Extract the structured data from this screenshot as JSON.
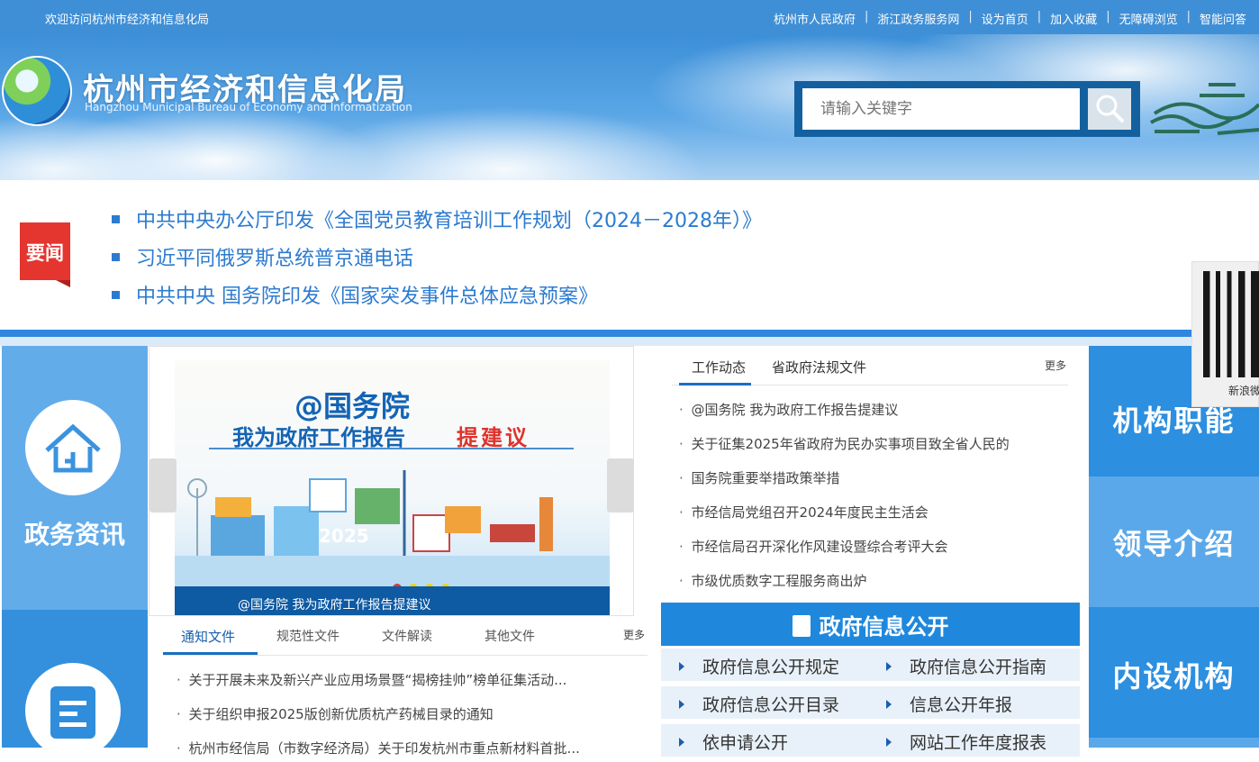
{
  "topbar": {
    "welcome": "欢迎访问杭州市经济和信息化局",
    "links": [
      "杭州市人民政府",
      "浙江政务服务网",
      "设为首页",
      "加入收藏",
      "无障碍浏览",
      "智能问答"
    ]
  },
  "header": {
    "title": "杭州市经济和信息化局",
    "subtitle": "Hangzhou Municipal Bureau of Economy and Informatization",
    "search_placeholder": "请输入关键字"
  },
  "headlines": {
    "badge": "要闻",
    "items": [
      "中共中央办公厅印发《全国党员教育培训工作规划（2024－2028年）》",
      "习近平同俄罗斯总统普京通电话",
      "中共中央  国务院印发《国家突发事件总体应急预案》"
    ]
  },
  "left_column": {
    "items": [
      {
        "label": "政务资讯",
        "icon": "home-icon"
      },
      {
        "label": "",
        "icon": "document-icon"
      }
    ]
  },
  "carousel": {
    "slide_title": "@国务院",
    "slide_line_blue": "我为政府工作报告",
    "slide_line_red": "提建议",
    "slide_year": "2025",
    "caption": "@国务院 我为政府工作报告提建议",
    "dots": 4,
    "active_dot": 0
  },
  "notice": {
    "tabs": [
      "通知文件",
      "规范性文件",
      "文件解读",
      "其他文件"
    ],
    "more": "更多",
    "items": [
      "关于开展未来及新兴产业应用场景暨“揭榜挂帅”榜单征集活动...",
      "关于组织申报2025版创新优质杭产药械目录的通知",
      "杭州市经信局（市数字经济局）关于印发杭州市重点新材料首批..."
    ]
  },
  "work": {
    "tabs": [
      "工作动态",
      "省政府法规文件"
    ],
    "more": "更多",
    "items": [
      "@国务院 我为政府工作报告提建议",
      "关于征集2025年省政府为民办实事项目致全省人民的",
      "国务院重要举措政策举措",
      "市经信局党组召开2024年度民主生活会",
      "市经信局召开深化作风建设暨综合考评大会",
      "市级优质数字工程服务商出炉"
    ]
  },
  "gov_info": {
    "title": "政府信息公开",
    "rows": [
      [
        "政府信息公开规定",
        "政府信息公开指南"
      ],
      [
        "政府信息公开目录",
        "信息公开年报"
      ],
      [
        "依申请公开",
        "网站工作年度报表"
      ]
    ]
  },
  "right_column": {
    "items": [
      "机构职能",
      "领导介绍",
      "内设机构"
    ]
  },
  "qr_float": {
    "label": "新浪微博"
  },
  "colors": {
    "topbar": "#3f8fd6",
    "accent_blue": "#2e86de",
    "badge_red": "#e4352f",
    "link_blue": "#2c7bd0"
  }
}
